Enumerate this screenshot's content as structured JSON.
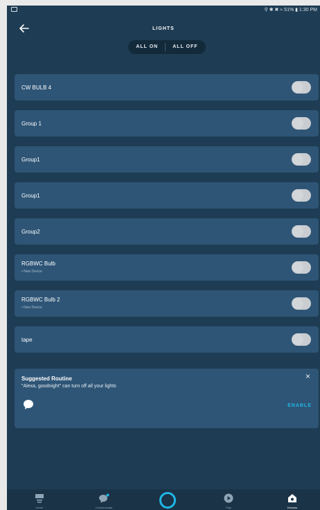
{
  "status_bar": {
    "right_text": "51% ▮ 1:30 PM",
    "icons": [
      "location-icon",
      "bluetooth-icon",
      "mute-icon",
      "wifi-icon",
      "battery-icon"
    ]
  },
  "header": {
    "title": "LIGHTS",
    "all_on": "ALL ON",
    "all_off": "ALL OFF"
  },
  "devices": [
    {
      "name": "CW BULB 4",
      "sub": ""
    },
    {
      "name": "Group 1",
      "sub": ""
    },
    {
      "name": "Group1",
      "sub": ""
    },
    {
      "name": "Group1",
      "sub": ""
    },
    {
      "name": "Group2",
      "sub": ""
    },
    {
      "name": "RGBWC Bulb",
      "sub": "• New Device"
    },
    {
      "name": "RGBWC Bulb 2",
      "sub": "• New Device"
    },
    {
      "name": "tape",
      "sub": ""
    }
  ],
  "routine": {
    "title": "Suggested Routine",
    "text": "\"Alexa, goodnight\" can turn off all your lights",
    "close": "×",
    "enable": "ENABLE"
  },
  "bottom_nav": {
    "home": "Home",
    "communicate": "Communicate",
    "play": "Play",
    "devices": "Devices"
  },
  "colors": {
    "background": "#1e3c53",
    "card": "#2e5576",
    "accent": "#1fb7e4",
    "toggle_off": "#c9cdd1"
  }
}
